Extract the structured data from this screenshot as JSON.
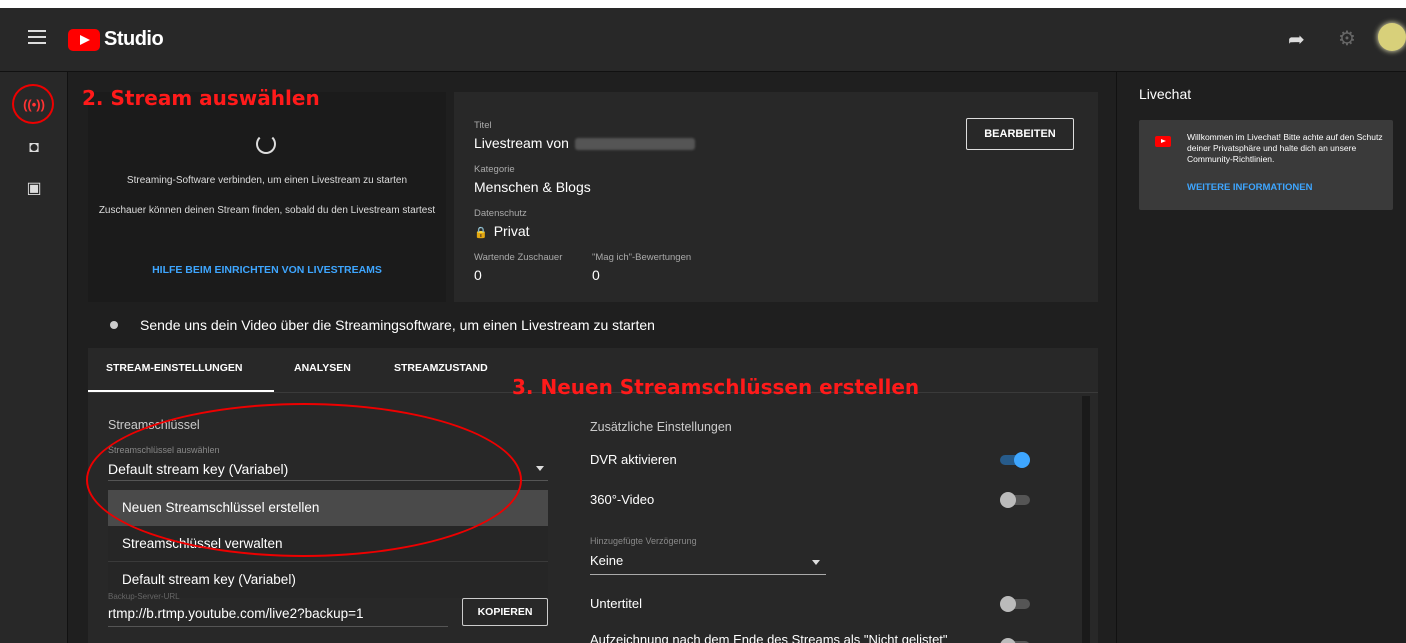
{
  "app": {
    "title": "Studio"
  },
  "annotations": {
    "step2": "2. Stream auswählen",
    "step3": "3. Neuen Streamschlüssen erstellen"
  },
  "preview": {
    "line1": "Streaming-Software verbinden, um einen Livestream zu starten",
    "line2": "Zuschauer können deinen Stream finden, sobald du den Livestream startest",
    "help_link": "HILFE BEIM EINRICHTEN VON LIVESTREAMS"
  },
  "info": {
    "title_label": "Titel",
    "title_value": "Livestream von",
    "category_label": "Kategorie",
    "category_value": "Menschen & Blogs",
    "privacy_label": "Datenschutz",
    "privacy_value": "Privat",
    "waiting_label": "Wartende Zuschauer",
    "waiting_value": "0",
    "likes_label": "\"Mag ich\"-Bewertungen",
    "likes_value": "0",
    "edit_button": "BEARBEITEN"
  },
  "status": {
    "text": "Sende uns dein Video über die Streamingsoftware, um einen Livestream zu starten"
  },
  "tabs": [
    {
      "label": "STREAM-EINSTELLUNGEN",
      "active": true
    },
    {
      "label": "ANALYSEN",
      "active": false
    },
    {
      "label": "STREAMZUSTAND",
      "active": false
    }
  ],
  "stream_key": {
    "section_title": "Streamschlüssel",
    "select_label": "Streamschlüssel auswählen",
    "selected": "Default stream key (Variabel)",
    "options": [
      "Neuen Streamschlüssel erstellen",
      "Streamschlüssel verwalten",
      "Default stream key (Variabel)"
    ],
    "backup_label": "Backup-Server-URL",
    "backup_url": "rtmp://b.rtmp.youtube.com/live2?backup=1",
    "copy_button": "KOPIEREN"
  },
  "extra_settings": {
    "title": "Zusätzliche Einstellungen",
    "dvr": {
      "label": "DVR aktivieren",
      "on": true
    },
    "video360": {
      "label": "360°-Video",
      "on": false
    },
    "delay_label": "Hinzugefügte Verzögerung",
    "delay_value": "Keine",
    "subtitles": {
      "label": "Untertitel",
      "on": false
    },
    "unlisted": {
      "label": "Aufzeichnung nach dem Ende des Streams als \"Nicht gelistet\"",
      "on": false
    }
  },
  "chat": {
    "title": "Livechat",
    "message": "Willkommen im Livechat! Bitte achte auf den Schutz deiner Privatsphäre und halte dich an unsere Community-Richtlinien.",
    "link": "WEITERE INFORMATIONEN"
  },
  "icons": {
    "menu": "hamburger-icon",
    "share": "share-arrow-icon",
    "settings": "gear-icon",
    "live": "broadcast-icon",
    "camera": "camera-icon",
    "calendar": "calendar-icon",
    "lock": "lock-icon"
  },
  "colors": {
    "accent": "#3ea6ff",
    "brand": "#ff0000",
    "annotation": "#ff1a1a"
  }
}
